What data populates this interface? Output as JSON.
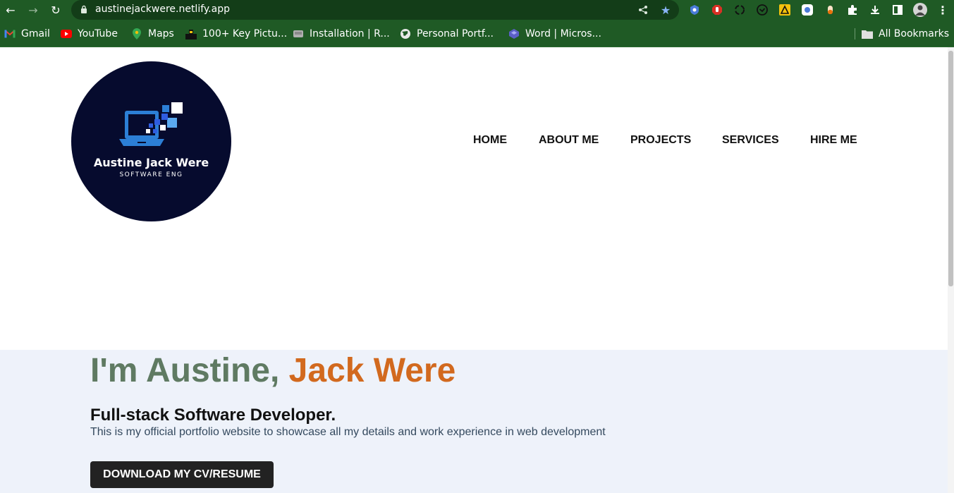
{
  "browser": {
    "url": "austinejackwere.netlify.app",
    "bookmarks": [
      {
        "label": "Gmail",
        "icon": "gmail-icon"
      },
      {
        "label": "YouTube",
        "icon": "youtube-icon"
      },
      {
        "label": "Maps",
        "icon": "maps-icon"
      },
      {
        "label": "100+ Key Pictu...",
        "icon": "picture-icon"
      },
      {
        "label": "Installation | R...",
        "icon": "installation-icon"
      },
      {
        "label": "Personal Portf...",
        "icon": "globe-icon"
      },
      {
        "label": "Word | Micros...",
        "icon": "word-icon"
      }
    ],
    "all_bookmarks": "All Bookmarks"
  },
  "logo": {
    "name": "Austine Jack Were",
    "subtitle": "SOFTWARE ENG"
  },
  "nav": {
    "items": [
      "HOME",
      "ABOUT ME",
      "PROJECTS",
      "SERVICES",
      "HIRE ME"
    ]
  },
  "hero": {
    "title_part1": "I'm Austine, ",
    "title_part2": "Jack Were",
    "subtitle": "Full-stack Software Developer.",
    "description": "This is my official portfolio website to showcase all my details and work experience in web development",
    "cv_button": "DOWNLOAD MY CV/RESUME"
  },
  "colors": {
    "chrome": "#1f5a25",
    "logo_bg": "#060b2e",
    "hero_bg": "#eef2fa",
    "title_grey": "#5f7a62",
    "title_orange": "#d2691e"
  }
}
